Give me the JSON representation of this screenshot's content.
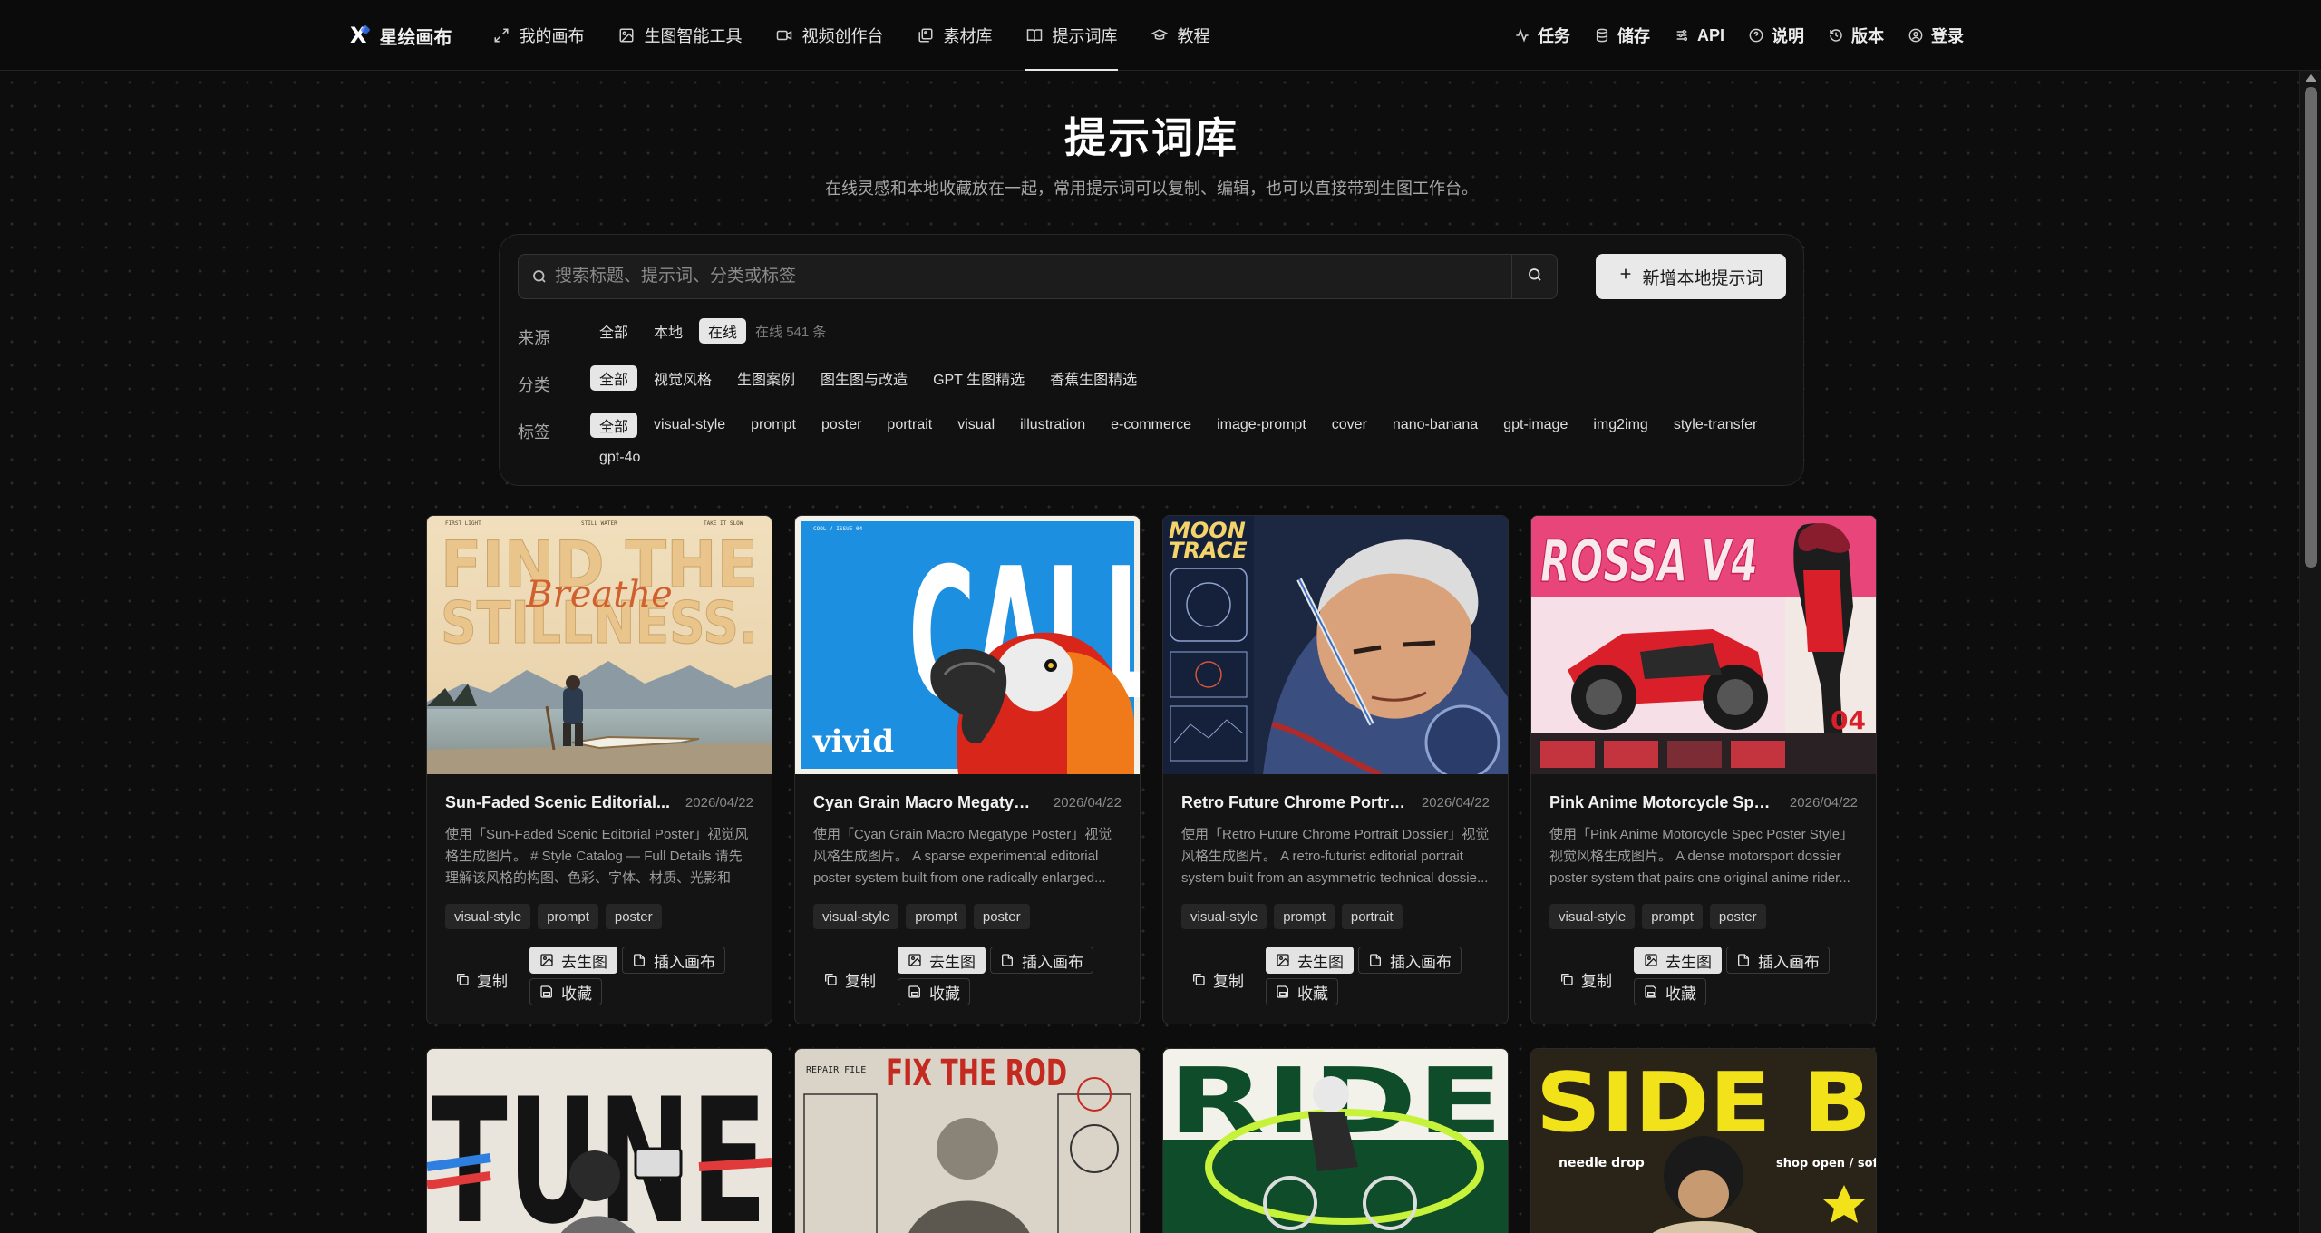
{
  "nav": {
    "brand": {
      "mark": "X",
      "name": "星绘画布"
    },
    "items": [
      {
        "label": "我的画布",
        "icon": "expand-icon"
      },
      {
        "label": "生图智能工具",
        "icon": "image-edit-icon"
      },
      {
        "label": "视频创作台",
        "icon": "video-icon"
      },
      {
        "label": "素材库",
        "icon": "gallery-icon"
      },
      {
        "label": "提示词库",
        "icon": "book-icon",
        "active": true
      },
      {
        "label": "教程",
        "icon": "graduation-cap-icon"
      }
    ],
    "right": [
      {
        "label": "任务",
        "icon": "activity-icon"
      },
      {
        "label": "储存",
        "icon": "database-icon"
      },
      {
        "label": "API",
        "icon": "sliders-icon"
      },
      {
        "label": "说明",
        "icon": "help-circle-icon"
      },
      {
        "label": "版本",
        "icon": "history-icon"
      },
      {
        "label": "登录",
        "icon": "user-circle-icon"
      }
    ]
  },
  "header": {
    "title": "提示词库",
    "subtitle": "在线灵感和本地收藏放在一起，常用提示词可以复制、编辑，也可以直接带到生图工作台。"
  },
  "search": {
    "placeholder": "搜索标题、提示词、分类或标签",
    "add_label": "新增本地提示词"
  },
  "filters": {
    "source": {
      "label": "来源",
      "options": [
        "全部",
        "本地",
        "在线"
      ],
      "selected": "在线",
      "meta": "在线 541 条"
    },
    "category": {
      "label": "分类",
      "options": [
        "全部",
        "视觉风格",
        "生图案例",
        "图生图与改造",
        "GPT 生图精选",
        "香蕉生图精选"
      ],
      "selected": "全部"
    },
    "tags": {
      "label": "标签",
      "options": [
        "全部",
        "visual-style",
        "prompt",
        "poster",
        "portrait",
        "visual",
        "illustration",
        "e-commerce",
        "image-prompt",
        "cover",
        "nano-banana",
        "gpt-image",
        "img2img",
        "style-transfer",
        "gpt-4o"
      ],
      "selected": "全部"
    }
  },
  "card_actions": {
    "copy": "复制",
    "generate": "去生图",
    "insert": "插入画布",
    "favorite": "收藏"
  },
  "cards": [
    {
      "title": "Sun-Faded Scenic Editorial...",
      "date": "2026/04/22",
      "desc": "使用「Sun-Faded Scenic Editorial Poster」视觉风格生成图片。 # Style Catalog — Full Details 请先理解该风格的构图、色彩、字体、材质、光影和版...",
      "tags": [
        "visual-style",
        "prompt",
        "poster"
      ],
      "image": {
        "line1": "FIND THE",
        "line2": "STILLNESS.",
        "script": "Breathe",
        "top_left": "FIRST LIGHT",
        "top_mid": "STILL WATER",
        "top_right": "TAKE IT SLOW"
      }
    },
    {
      "title": "Cyan Grain Macro Megatype...",
      "date": "2026/04/22",
      "desc": "使用「Cyan Grain Macro Megatype Poster」视觉风格生成图片。 A sparse experimental editorial poster system built from one radically enlarged...",
      "tags": [
        "visual-style",
        "prompt",
        "poster"
      ],
      "image": {
        "word": "CALL",
        "script": "vivid",
        "corner": "COOL / ISSUE 04"
      }
    },
    {
      "title": "Retro Future Chrome Portrait...",
      "date": "2026/04/22",
      "desc": "使用「Retro Future Chrome Portrait Dossier」视觉风格生成图片。 A retro-futurist editorial portrait system built from an asymmetric technical dossie...",
      "tags": [
        "visual-style",
        "prompt",
        "portrait"
      ],
      "image": {
        "line1": "MOON",
        "line2": "TRACE"
      }
    },
    {
      "title": "Pink Anime Motorcycle Spec...",
      "date": "2026/04/22",
      "desc": "使用「Pink Anime Motorcycle Spec Poster Style」视觉风格生成图片。 A dense motorsport dossier poster system that pairs one original anime rider...",
      "tags": [
        "visual-style",
        "prompt",
        "poster"
      ],
      "image": {
        "word": "ROSSA V4",
        "number": "04"
      }
    }
  ],
  "cards_row2": [
    {
      "word": "TUNE"
    },
    {
      "word": "FIX THE ROD",
      "label": "REPAIR FILE"
    },
    {
      "word": "RIDE"
    },
    {
      "word": "SIDE B",
      "left": "needle drop",
      "right": "shop open / soft s"
    }
  ]
}
